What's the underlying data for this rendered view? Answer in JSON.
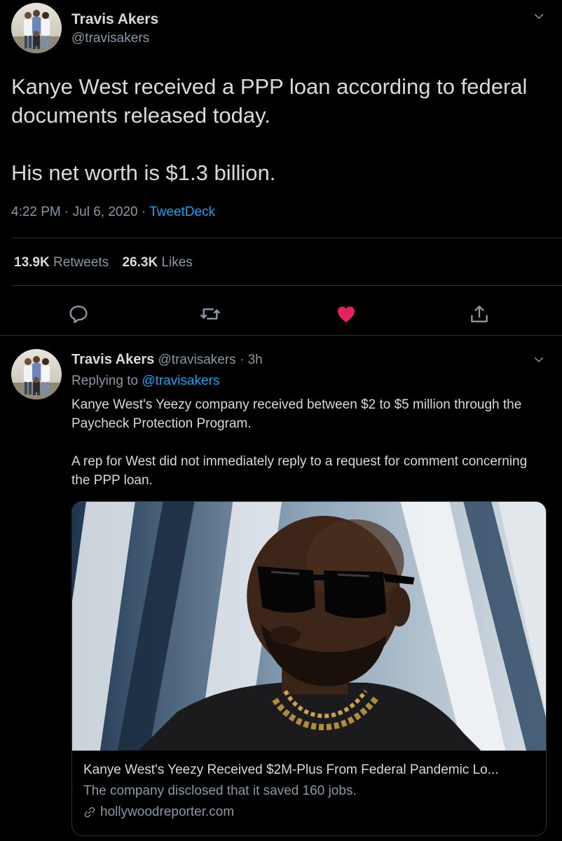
{
  "tweet": {
    "author_name": "Travis Akers",
    "author_handle": "@travisakers",
    "text": "Kanye West received a PPP loan according to federal documents released today.\n\nHis net worth is $1.3 billion.",
    "time": "4:22 PM",
    "date": "Jul 6, 2020",
    "source": "TweetDeck",
    "retweets_count": "13.9K",
    "retweets_label": "Retweets",
    "likes_count": "26.3K",
    "likes_label": "Likes",
    "liked": true,
    "like_color": "#e0245e"
  },
  "reply": {
    "author_name": "Travis Akers",
    "author_handle": "@travisakers",
    "age": "3h",
    "replying_prefix": "Replying to",
    "replying_to": "@travisakers",
    "text": "Kanye West's Yeezy company received between $2 to $5 million through the Paycheck Protection Program.\n\nA rep for West did not immediately reply to a request for comment concerning the PPP loan.",
    "card": {
      "title": "Kanye West's Yeezy Received $2M-Plus From Federal Pandemic Lo...",
      "description": "The company disclosed that it saved 160 jobs.",
      "domain": "hollywoodreporter.com"
    }
  },
  "colors": {
    "accent": "#1da1f2",
    "muted": "#8899a6",
    "text": "#d9d9d9",
    "background": "#000000",
    "like": "#e0245e"
  },
  "icons": {
    "menu": "chevron-down-icon",
    "reply": "comment-icon",
    "retweet": "retweet-icon",
    "like": "heart-icon",
    "share": "share-icon",
    "link": "link-icon"
  }
}
